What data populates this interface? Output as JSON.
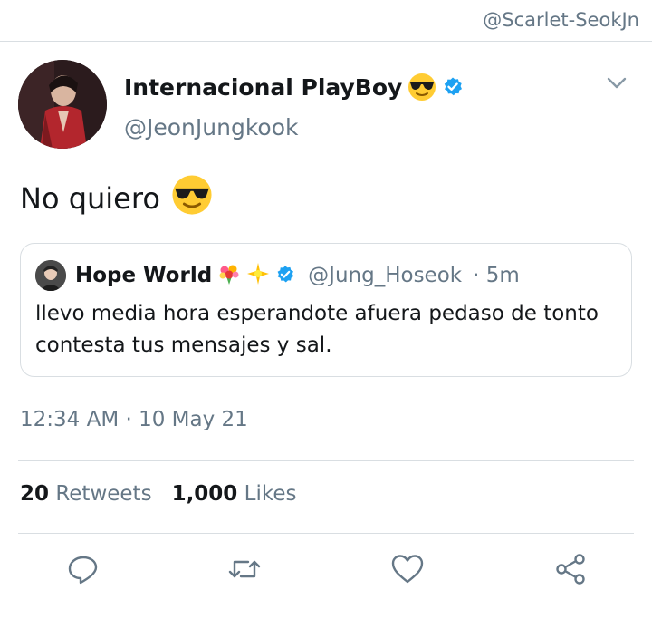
{
  "watermark": "@Scarlet-SeokJn",
  "author": {
    "display_name": "Internacional PlayBoy",
    "handle": "@JeonJungkook",
    "verified": true
  },
  "tweet": {
    "text": "No quiero",
    "emoji": "sunglasses-emoji"
  },
  "quoted_tweet": {
    "display_name": "Hope World",
    "emojis": [
      "bouquet-emoji",
      "sparkle-emoji"
    ],
    "handle": "@Jung_Hoseok",
    "time": "· 5m",
    "text": "llevo media hora esperandote afuera pedaso de tonto contesta tus mensajes y sal."
  },
  "timestamp": "12:34 AM · 10 May 21",
  "stats": {
    "retweets_count": "20",
    "retweets_label": "Retweets",
    "likes_count": "1,000",
    "likes_label": "Likes"
  },
  "actions": [
    "reply-icon",
    "retweet-icon",
    "like-icon",
    "share-icon"
  ],
  "colors": {
    "verified": "#1da1f2",
    "secondary_text": "#657786",
    "divider": "#d9dee2"
  }
}
